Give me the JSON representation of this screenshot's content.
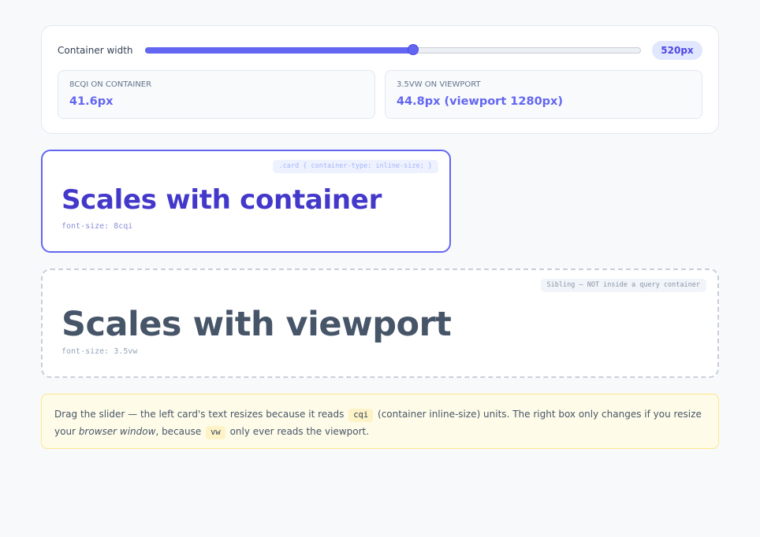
{
  "controls": {
    "slider_label": "Container width",
    "slider_value_fraction": 0.54,
    "badge": "520px"
  },
  "stats": {
    "container": {
      "label": "8cqi on container",
      "value": "41.6px"
    },
    "viewport": {
      "label": "3.5vw on viewport",
      "value": "44.8px (viewport 1280px)"
    }
  },
  "card_container": {
    "tag": ".card { container-type: inline-size; }",
    "title": "Scales with container",
    "caption": "font-size: 8cqi"
  },
  "card_viewport": {
    "tag": "Sibling — NOT inside a query container",
    "title": "Scales with viewport",
    "caption": "font-size: 3.5vw"
  },
  "note": {
    "part1": "Drag the slider — the left card's text resizes because it reads",
    "code1": "cqi",
    "part2": "(container inline-size) units. The right box only changes if you resize your",
    "em": "browser window",
    "part3": ", because",
    "code2": "vw",
    "part4": "only ever reads the viewport."
  },
  "colors": {
    "accent": "#6366f1",
    "accent_dark": "#4338ca",
    "note_bg": "#fefce8",
    "note_border": "#fde68a"
  }
}
